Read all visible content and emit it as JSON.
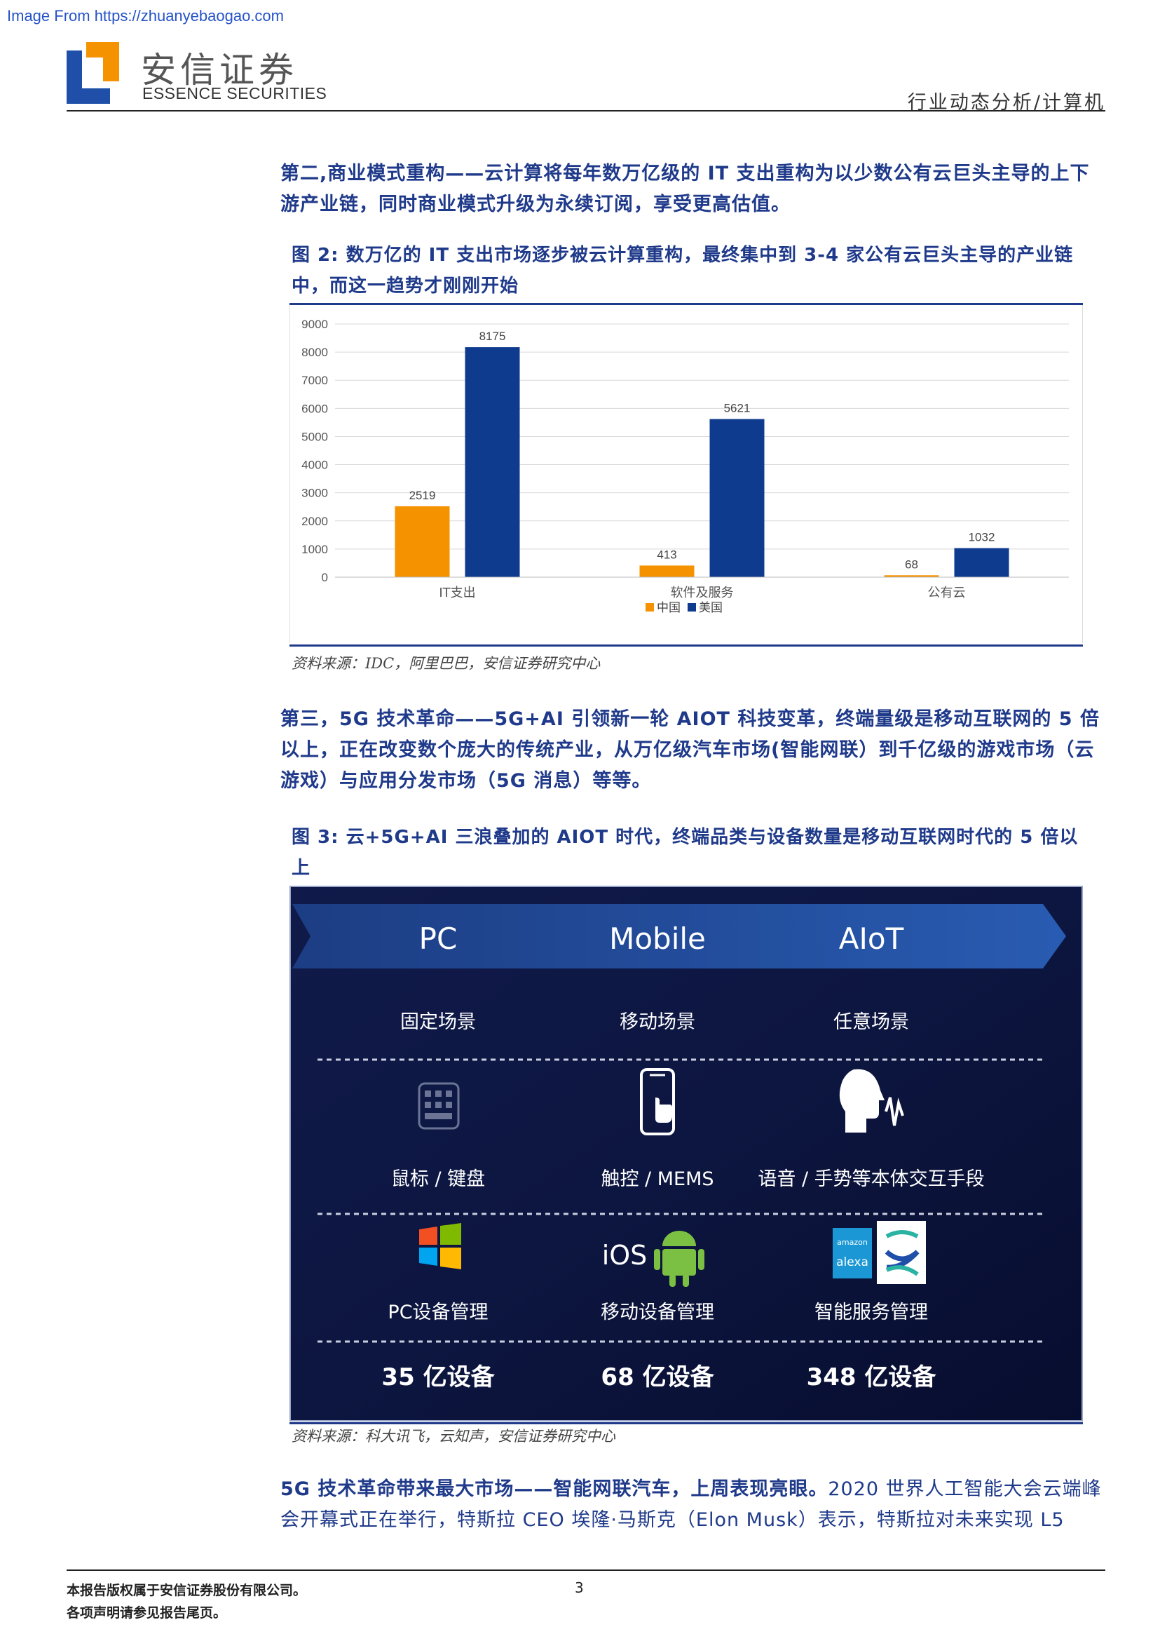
{
  "watermark": "Image From https://zhuanyebaogao.com",
  "header": {
    "logo_cn": "安信证券",
    "logo_en": "ESSENCE SECURITIES",
    "section": "行业动态分析/计算机"
  },
  "para1": {
    "text": "第二,商业模式重构——云计算将每年数万亿级的 IT 支出重构为以少数公有云巨头主导的上下游产业链，同时商业模式升级为永续订阅，享受更高估值。"
  },
  "figure2": {
    "title": "图 2: 数万亿的 IT 支出市场逐步被云计算重构，最终集中到 3-4 家公有云巨头主导的产业链中，而这一趋势才刚刚开始",
    "source": "资料来源：IDC，阿里巴巴，安信证券研究中心"
  },
  "chart_data": {
    "type": "bar",
    "categories": [
      "IT支出",
      "软件及服务",
      "公有云"
    ],
    "series": [
      {
        "name": "中国",
        "values": [
          2519,
          413,
          68
        ],
        "color": "#f59200"
      },
      {
        "name": "美国",
        "values": [
          8175,
          5621,
          1032
        ],
        "color": "#0f3b8f"
      }
    ],
    "ylim": [
      0,
      9000
    ],
    "yticks": [
      "0",
      "1000",
      "2000",
      "3000",
      "4000",
      "5000",
      "6000",
      "7000",
      "8000",
      "9000"
    ],
    "grid": true,
    "legend_position": "bottom"
  },
  "para2": {
    "text": "第三，5G 技术革命——5G+AI 引领新一轮 AIOT 科技变革，终端量级是移动互联网的 5 倍以上，正在改变数个庞大的传统产业，从万亿级汽车市场(智能网联）到千亿级的游戏市场（云游戏）与应用分发市场（5G 消息）等等。"
  },
  "figure3": {
    "title": "图 3: 云+5G+AI 三浪叠加的 AIOT 时代，终端品类与设备数量是移动互联网时代的 5 倍以上",
    "source": "资料来源：科大讯飞，云知声，安信证券研究中心",
    "columns": [
      {
        "era": "PC",
        "scene": "固定场景",
        "input": "鼠标 / 键盘",
        "mgmt": "PC设备管理",
        "devices": "35 亿设备",
        "icon": "keyboard-icon",
        "os_icon": "windows-icon"
      },
      {
        "era": "Mobile",
        "scene": "移动场景",
        "input": "触控 / MEMS",
        "mgmt": "移动设备管理",
        "devices": "68 亿设备",
        "icon": "phone-touch-icon",
        "os_icon": "ios-android-icon"
      },
      {
        "era": "AIoT",
        "scene": "任意场景",
        "input": "语音 / 手势等本体交互手段",
        "mgmt": "智能服务管理",
        "devices": "348 亿设备",
        "icon": "voice-icon",
        "os_icon": "alexa-icon"
      }
    ],
    "ios_text": "iOS",
    "amazon_text": "amazon",
    "alexa_text": "alexa"
  },
  "para3": {
    "bold": "5G 技术革命带来最大市场——智能网联汽车，上周表现亮眼。",
    "normal": "2020 世界人工智能大会云端峰会开幕式正在举行，特斯拉 CEO 埃隆·马斯克（Elon Musk）表示，特斯拉对未来实现 L5"
  },
  "footer": {
    "line1": "本报告版权属于安信证券股份有限公司。",
    "line2": "各项声明请参见报告尾页。",
    "page": "3"
  }
}
